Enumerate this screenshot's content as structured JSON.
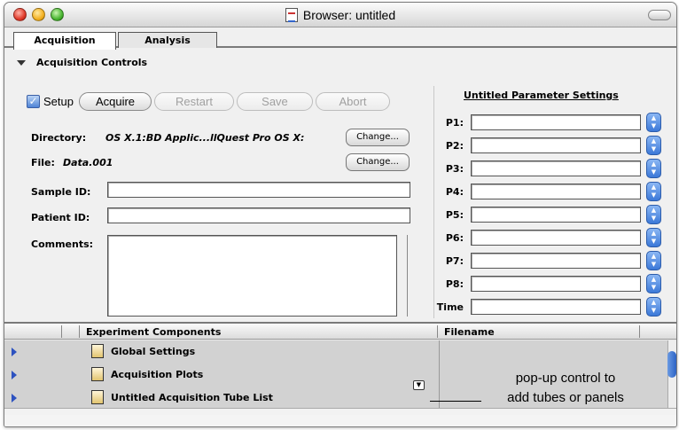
{
  "window": {
    "title": "Browser: untitled"
  },
  "tabs": [
    {
      "label": "Acquisition",
      "active": true
    },
    {
      "label": "Analysis",
      "active": false
    }
  ],
  "section": {
    "label": "Acquisition Controls"
  },
  "controls": {
    "setup_label": "Setup",
    "setup_checked": true,
    "buttons": [
      {
        "label": "Acquire",
        "enabled": true
      },
      {
        "label": "Restart",
        "enabled": false
      },
      {
        "label": "Save",
        "enabled": false
      },
      {
        "label": "Abort",
        "enabled": false
      }
    ]
  },
  "fields": {
    "directory_label": "Directory:",
    "directory_value": "OS X.1:BD Applic...llQuest Pro OS X:",
    "file_label": "File:",
    "file_value": "Data.001",
    "change_label": "Change...",
    "sample_id_label": "Sample ID:",
    "sample_id_value": "",
    "patient_id_label": "Patient ID:",
    "patient_id_value": "",
    "comments_label": "Comments:",
    "comments_value": ""
  },
  "params": {
    "title": "Untitled Parameter Settings",
    "rows": [
      {
        "label": "P1:",
        "value": ""
      },
      {
        "label": "P2:",
        "value": ""
      },
      {
        "label": "P3:",
        "value": ""
      },
      {
        "label": "P4:",
        "value": ""
      },
      {
        "label": "P5:",
        "value": ""
      },
      {
        "label": "P6:",
        "value": ""
      },
      {
        "label": "P7:",
        "value": ""
      },
      {
        "label": "P8:",
        "value": ""
      },
      {
        "label": "Time",
        "value": ""
      }
    ]
  },
  "browser": {
    "columns": [
      "Experiment Components",
      "Filename"
    ],
    "rows": [
      {
        "label": "Global Settings"
      },
      {
        "label": "Acquisition Plots"
      },
      {
        "label": "Untitled Acquisition Tube List"
      }
    ]
  },
  "callout": {
    "line1": "pop-up control to",
    "line2": "add tubes or panels"
  },
  "colors": {
    "accent": "#3b78d8",
    "disclosure": "#2d52c0",
    "list_bg": "#d2d2d2"
  }
}
